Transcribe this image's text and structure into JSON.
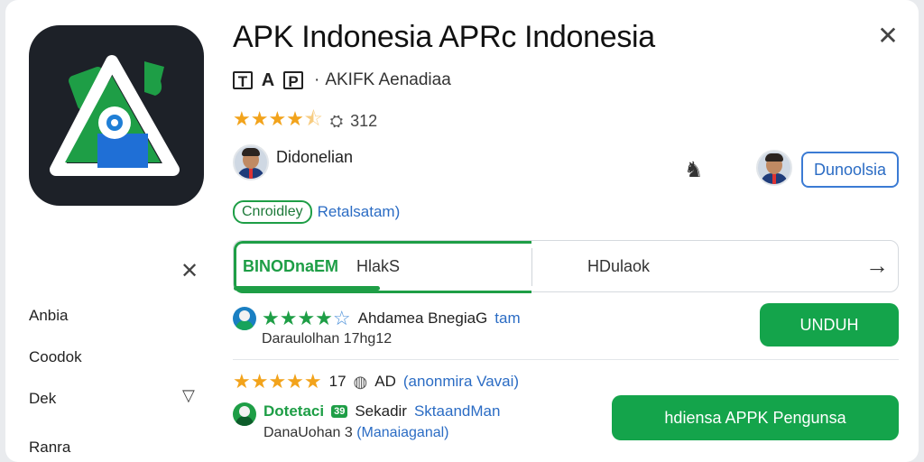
{
  "app": {
    "title": "APK Indonesia APRc Indonesia",
    "developer_glyphs": [
      "T",
      "A",
      "P"
    ],
    "developer_sep": "·",
    "developer_name": "AKIFK Aenadiaa",
    "rating_stars": "★★★★",
    "rating_half": "⯪",
    "rating_count": "312",
    "author_name": "Didonelian",
    "author_button": "Dunoolsia",
    "chip_label": "Cnroidley",
    "chip_link": "Retalsatam)"
  },
  "tabs": {
    "active_label": "BINODnaEM",
    "active_sub": "HlakS",
    "second_label": "HDulaok",
    "progress": 0.22
  },
  "sidebar": {
    "items": [
      {
        "label": "Anbia"
      },
      {
        "label": "Coodok"
      },
      {
        "label": "Dek"
      },
      {
        "label": "Ranra"
      }
    ]
  },
  "list": {
    "item1": {
      "stars": "★★★★",
      "star_empty": "☆",
      "name": "Ahdamea BnegiaG",
      "tag": "tam",
      "sub": "Daraulolhan",
      "sub_value": "17hg12",
      "button": "UNDUH"
    },
    "item2": {
      "stars": "★★★★★",
      "count": "17",
      "badge_text": "AD",
      "paren_text": "(anonmira Vavai)",
      "name": "Dotetaci",
      "badge": "39",
      "name2": "Sekadir",
      "link": "SktaandMan",
      "sub": "DanaUohan",
      "sub_num": "3",
      "sub_link": "(Manaiaganal)",
      "button": "hdiensa APPK Pengunsa"
    }
  },
  "icons": {
    "close": "close-icon",
    "arrow": "arrow-right-icon",
    "people": "people-icon",
    "chevron": "chevron-down-icon"
  },
  "colors": {
    "accent_green": "#14a44b",
    "link_blue": "#2b6cc4",
    "star_orange": "#f2a31b"
  }
}
